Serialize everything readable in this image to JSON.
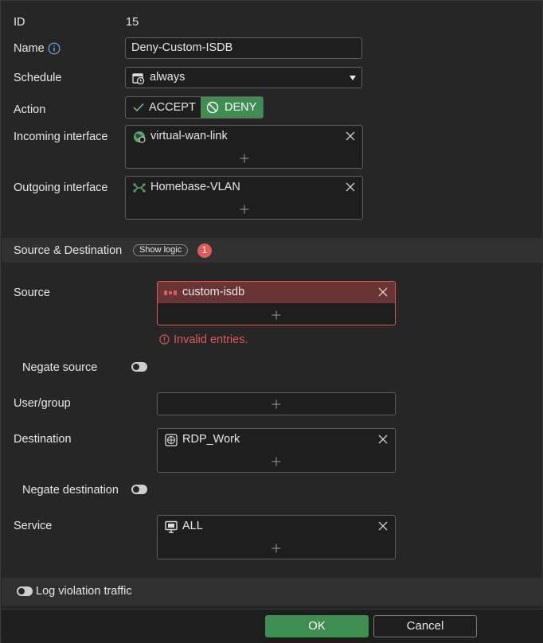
{
  "form": {
    "id_label": "ID",
    "id_value": "15",
    "name_label": "Name",
    "name_value": "Deny-Custom-ISDB",
    "schedule_label": "Schedule",
    "schedule_value": "always",
    "action_label": "Action",
    "action_accept": "ACCEPT",
    "action_deny": "DENY",
    "incoming_label": "Incoming interface",
    "incoming_value": "virtual-wan-link",
    "outgoing_label": "Outgoing interface",
    "outgoing_value": "Homebase-VLAN"
  },
  "section": {
    "title": "Source & Destination",
    "show_logic": "Show logic",
    "error_count": "1"
  },
  "source": {
    "label": "Source",
    "value": "custom-isdb",
    "error": "Invalid entries.",
    "negate_label": "Negate source"
  },
  "user_group": {
    "label": "User/group"
  },
  "destination": {
    "label": "Destination",
    "value": "RDP_Work",
    "negate_label": "Negate destination"
  },
  "service": {
    "label": "Service",
    "value": "ALL"
  },
  "log": {
    "label": "Log violation traffic"
  },
  "footer": {
    "ok": "OK",
    "cancel": "Cancel"
  },
  "colors": {
    "deny_active": "#3e8e52",
    "error_red": "#e05a5a",
    "ok_button": "#3e8e52"
  }
}
